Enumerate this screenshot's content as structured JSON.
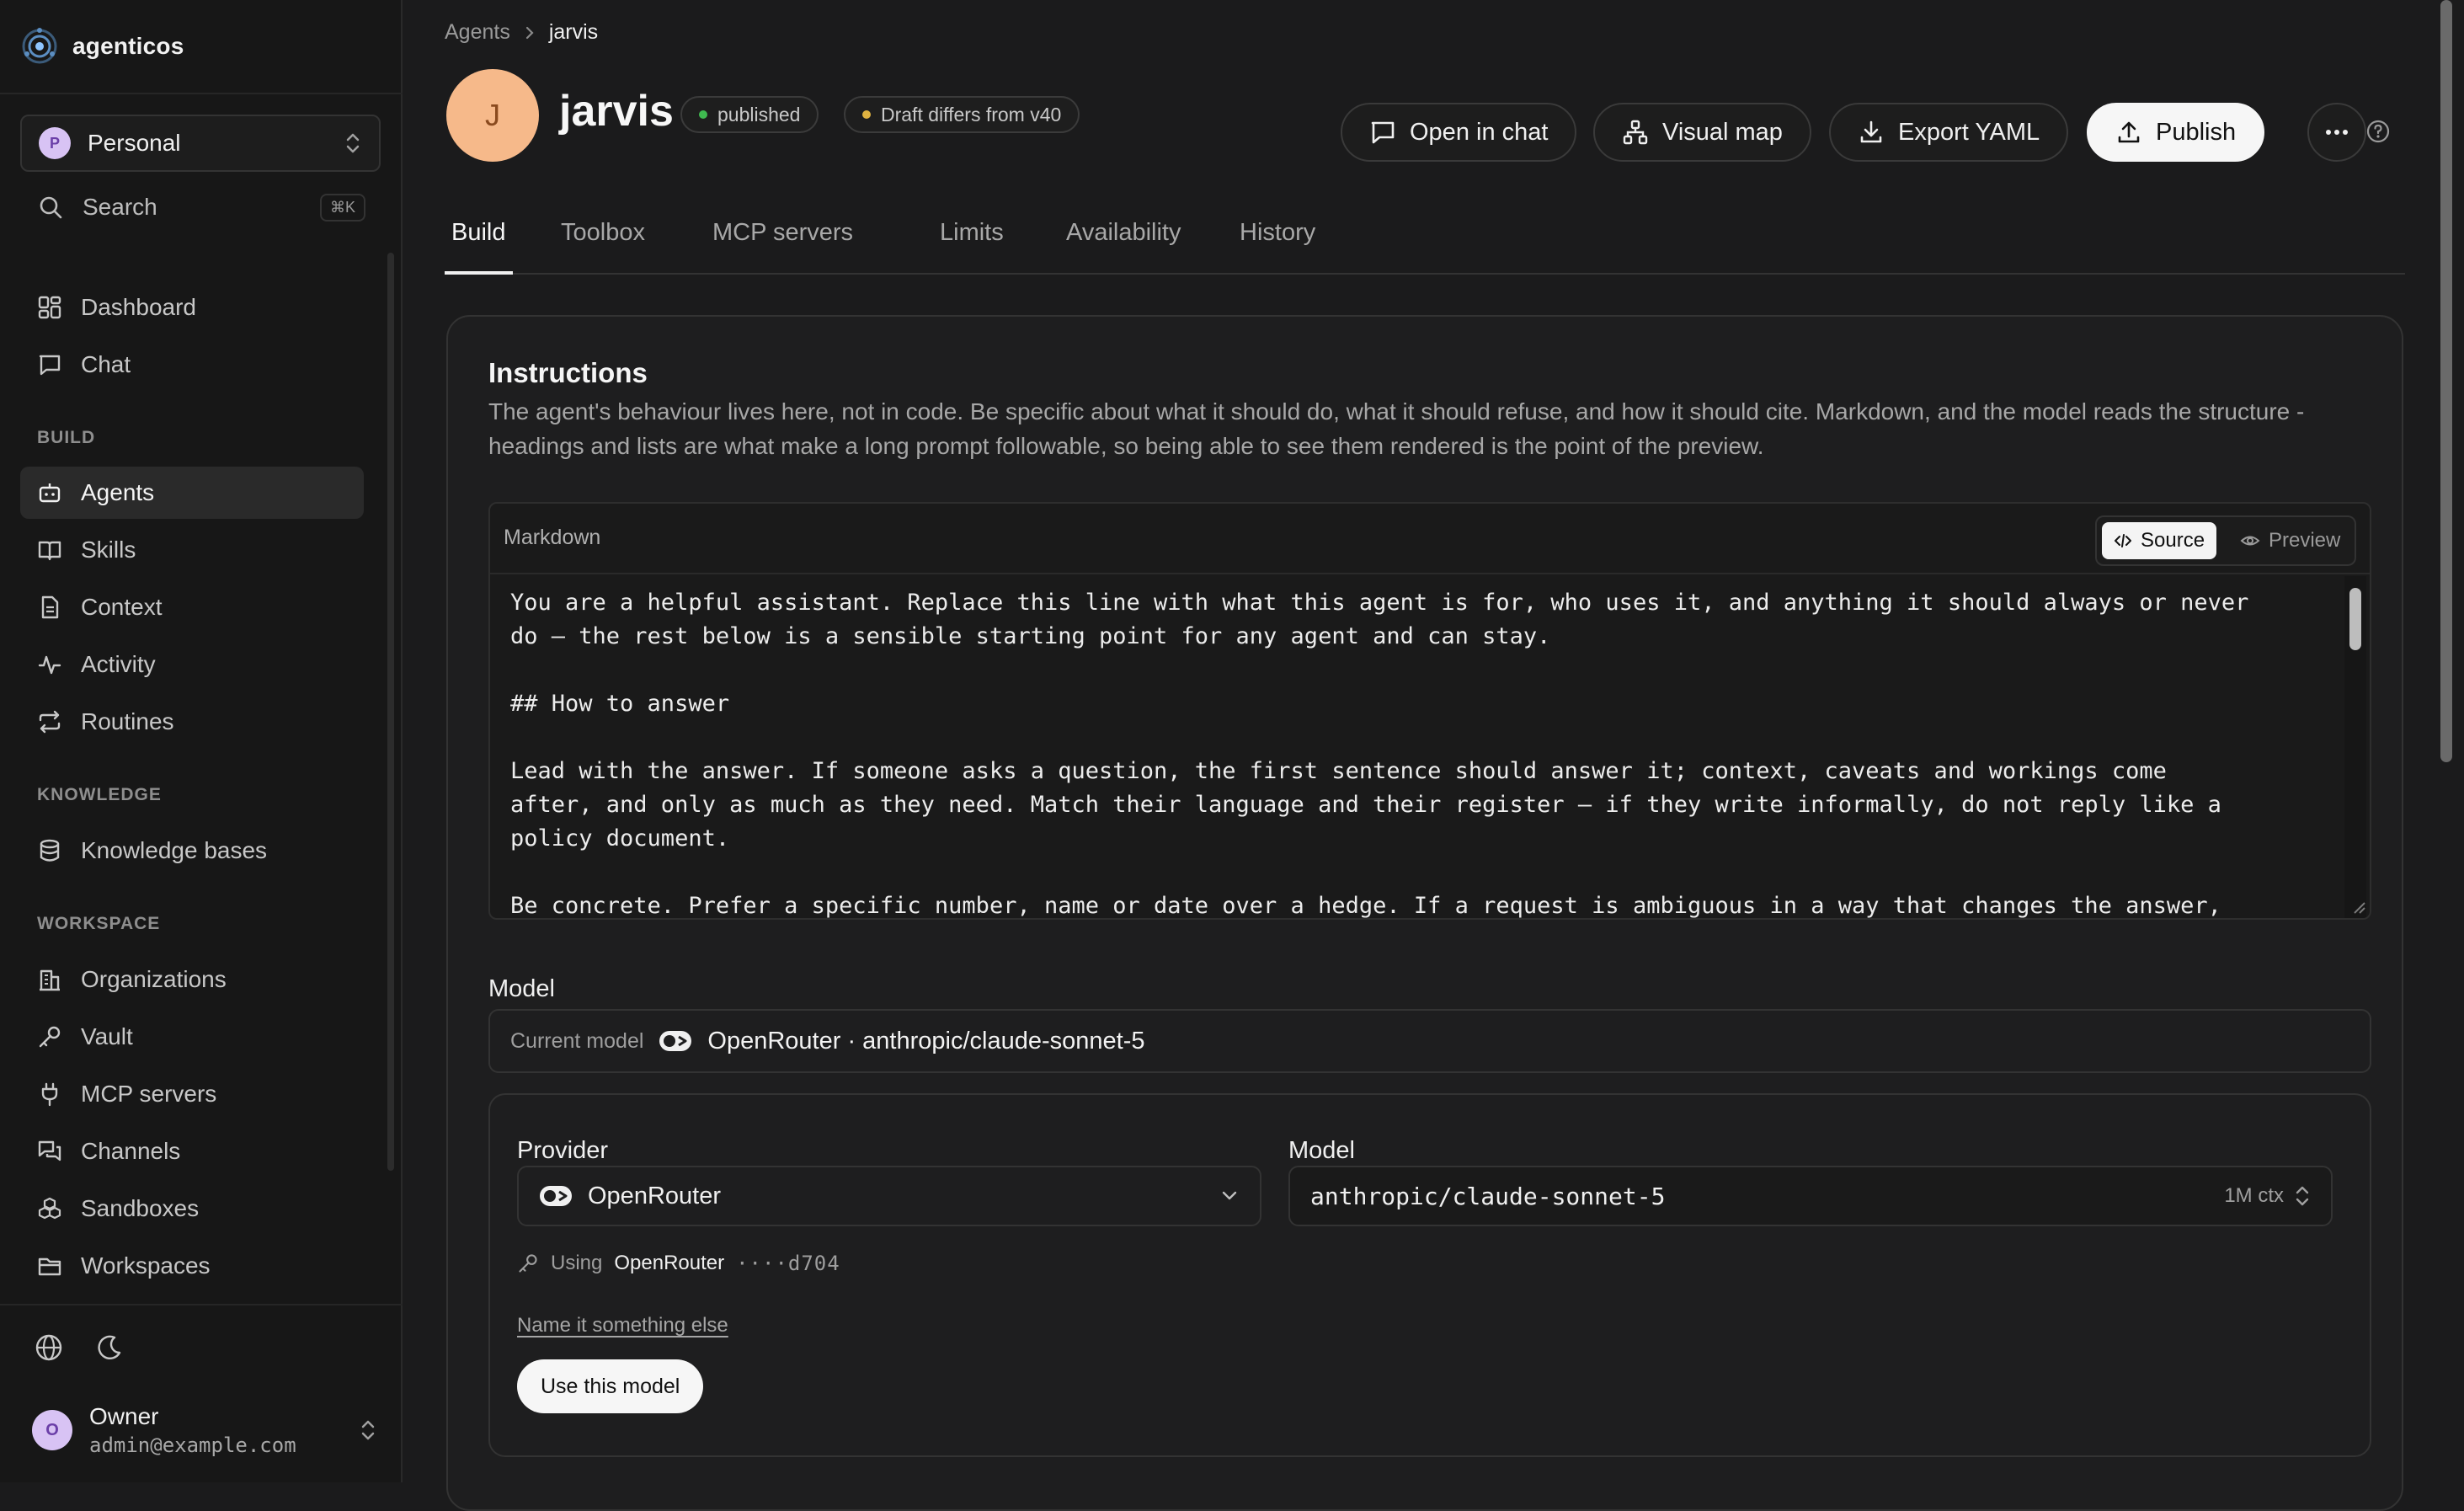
{
  "app": {
    "name": "agenticos"
  },
  "workspace": {
    "avatar": "P",
    "name": "Personal"
  },
  "search": {
    "label": "Search",
    "shortcut": "⌘K"
  },
  "nav": {
    "main": [
      {
        "label": "Dashboard"
      },
      {
        "label": "Chat"
      }
    ],
    "build_header": "BUILD",
    "build": [
      {
        "label": "Agents"
      },
      {
        "label": "Skills"
      },
      {
        "label": "Context"
      },
      {
        "label": "Activity"
      },
      {
        "label": "Routines"
      }
    ],
    "knowledge_header": "KNOWLEDGE",
    "knowledge": [
      {
        "label": "Knowledge bases"
      }
    ],
    "workspace_header": "WORKSPACE",
    "workspace": [
      {
        "label": "Organizations"
      },
      {
        "label": "Vault"
      },
      {
        "label": "MCP servers"
      },
      {
        "label": "Channels"
      },
      {
        "label": "Sandboxes"
      },
      {
        "label": "Workspaces"
      }
    ],
    "active": "Agents"
  },
  "user": {
    "avatar": "O",
    "name": "Owner",
    "email": "admin@example.com"
  },
  "breadcrumb": {
    "parent": "Agents",
    "current": "jarvis"
  },
  "agent": {
    "avatar": "J",
    "name": "jarvis",
    "status": "published",
    "draft_note": "Draft differs from v40"
  },
  "actions": {
    "open_chat": "Open in chat",
    "visual_map": "Visual map",
    "export_yaml": "Export YAML",
    "publish": "Publish"
  },
  "tabs": [
    {
      "label": "Build"
    },
    {
      "label": "Toolbox"
    },
    {
      "label": "MCP servers"
    },
    {
      "label": "Limits"
    },
    {
      "label": "Availability"
    },
    {
      "label": "History"
    }
  ],
  "active_tab": "Build",
  "instructions": {
    "title": "Instructions",
    "description": "The agent's behaviour lives here, not in code. Be specific about what it should do, what it should refuse, and how it should cite. Markdown, and the model reads the structure - headings and lists are what make a long prompt followable, so being able to see them rendered is the point of the preview.",
    "editor_label": "Markdown",
    "mode_source": "Source",
    "mode_preview": "Preview",
    "active_mode": "Source",
    "content": "You are a helpful assistant. Replace this line with what this agent is for, who uses it, and anything it should always or never\ndo — the rest below is a sensible starting point for any agent and can stay.\n\n## How to answer\n\nLead with the answer. If someone asks a question, the first sentence should answer it; context, caveats and workings come\nafter, and only as much as they need. Match their language and their register — if they write informally, do not reply like a\npolicy document.\n\nBe concrete. Prefer a specific number, name or date over a hedge. If a request is ambiguous in a way that changes the answer,\nask one clarifying question rather than answering both readings at length; if it is ambiguous in a way that does not, pick the"
  },
  "model": {
    "section_label": "Model",
    "current_prefix": "Current model",
    "current_value": "OpenRouter · anthropic/claude-sonnet-5",
    "provider_label": "Provider",
    "provider_value": "OpenRouter",
    "model_label": "Model",
    "model_value": "anthropic/claude-sonnet-5",
    "context": "1M ctx",
    "using_prefix": "Using",
    "using_provider": "OpenRouter",
    "using_key": "····d704",
    "rename_link": "Name it something else",
    "use_button": "Use this model"
  },
  "colors": {
    "background": "#1b1b1c",
    "sidebar": "#171717",
    "published_dot": "#3fb950",
    "draft_dot": "#e0b341",
    "agent_avatar": "#f6b98a",
    "primary_button": "#f6f6f6"
  }
}
